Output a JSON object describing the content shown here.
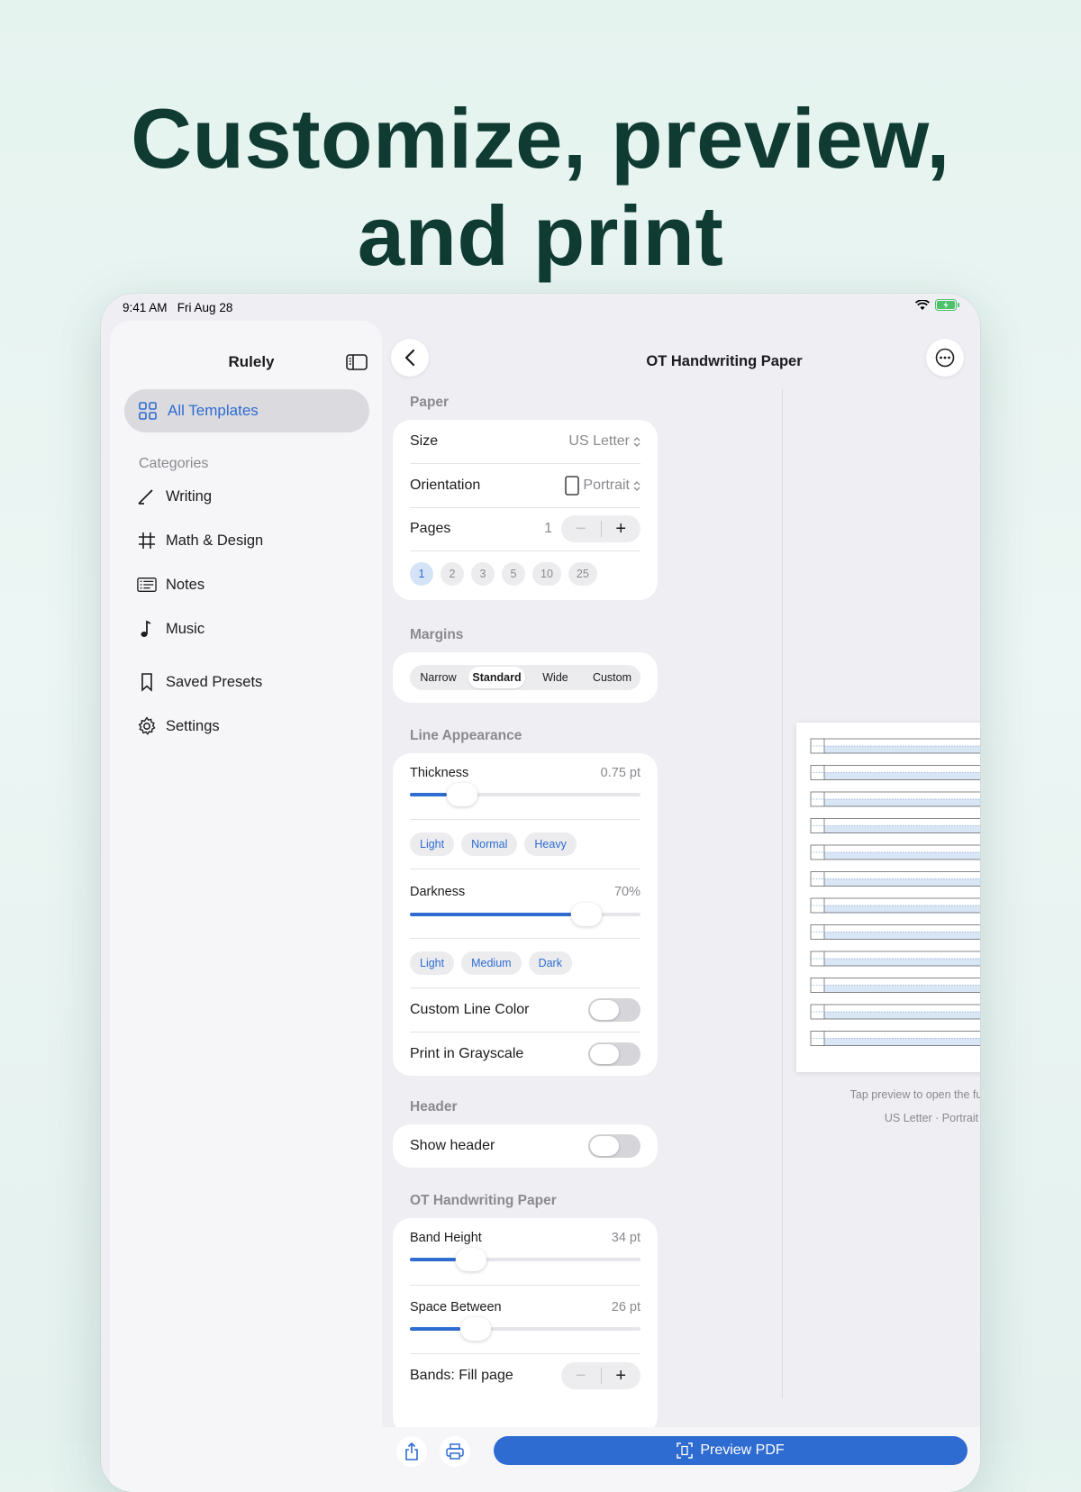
{
  "headline": {
    "line1": "Customize, preview,",
    "line2": "and print"
  },
  "status": {
    "time": "9:41 AM",
    "date": "Fri Aug 28"
  },
  "sidebar": {
    "title": "Rulely",
    "selected": "All Templates",
    "categories_label": "Categories",
    "items": [
      {
        "label": "Writing",
        "icon": "pencil-icon"
      },
      {
        "label": "Math & Design",
        "icon": "grid-hash-icon"
      },
      {
        "label": "Notes",
        "icon": "notes-icon"
      },
      {
        "label": "Music",
        "icon": "music-note-icon"
      },
      {
        "label": "Saved Presets",
        "icon": "bookmark-icon"
      },
      {
        "label": "Settings",
        "icon": "gear-icon"
      }
    ]
  },
  "detail": {
    "title": "OT Handwriting Paper",
    "paper": {
      "label": "Paper",
      "size_label": "Size",
      "size_value": "US Letter",
      "orientation_label": "Orientation",
      "orientation_value": "Portrait",
      "pages_label": "Pages",
      "pages_value": "1",
      "stepper_minus": "−",
      "stepper_plus": "+",
      "page_chips": [
        "1",
        "2",
        "3",
        "5",
        "10",
        "25"
      ],
      "selected_chip": "1"
    },
    "margins": {
      "label": "Margins",
      "options": [
        "Narrow",
        "Standard",
        "Wide",
        "Custom"
      ],
      "selected": "Standard"
    },
    "line": {
      "label": "Line Appearance",
      "thickness_label": "Thickness",
      "thickness_value": "0.75 pt",
      "thickness_level": 0.16,
      "thickness_presets": [
        "Light",
        "Normal",
        "Heavy"
      ],
      "darkness_label": "Darkness",
      "darkness_value": "70%",
      "darkness_level": 0.7,
      "darkness_presets": [
        "Light",
        "Medium",
        "Dark"
      ],
      "custom_color_label": "Custom Line Color",
      "custom_color_on": false,
      "grayscale_label": "Print in Grayscale",
      "grayscale_on": false
    },
    "header": {
      "label": "Header",
      "show_label": "Show header",
      "show_on": false
    },
    "ot": {
      "label": "OT Handwriting Paper",
      "band_height_label": "Band Height",
      "band_height_value": "34 pt",
      "band_height_level": 0.2,
      "space_between_label": "Space Between",
      "space_between_value": "26 pt",
      "space_between_level": 0.22,
      "bands_label": "Bands: Fill page"
    },
    "preview": {
      "caption1": "Tap preview to open the full PDF",
      "caption2": "US Letter · Portrait",
      "band_count": 12
    },
    "bottom": {
      "preview_pdf_label": "Preview PDF"
    }
  },
  "colors": {
    "accent": "#2e6cd1",
    "headline": "#0f3b32",
    "background": "#e5f3ef"
  }
}
